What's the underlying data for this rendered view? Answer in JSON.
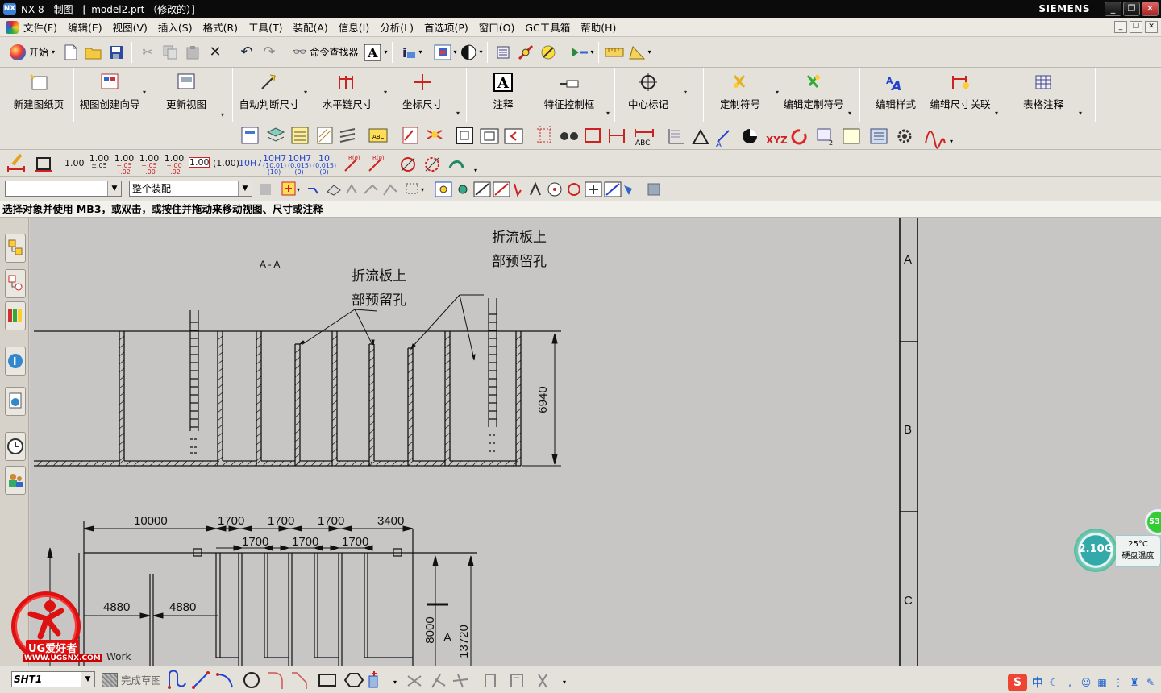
{
  "window": {
    "title": "NX 8 - 制图 - [_model2.prt （修改的）]",
    "brand": "SIEMENS",
    "controls": [
      "_",
      "❐",
      "✕"
    ]
  },
  "menubar": {
    "items": [
      "文件(F)",
      "编辑(E)",
      "视图(V)",
      "插入(S)",
      "格式(R)",
      "工具(T)",
      "装配(A)",
      "信息(I)",
      "分析(L)",
      "首选项(P)",
      "窗口(O)",
      "GC工具箱",
      "帮助(H)"
    ]
  },
  "standard_toolbar": {
    "start_label": "开始",
    "command_finder_label": "命令查找器"
  },
  "drafting_toolbar": {
    "buttons": [
      "新建图纸页",
      "视图创建向导",
      "更新视图",
      "自动判断尺寸",
      "水平链尺寸",
      "坐标尺寸",
      "注释",
      "特征控制框",
      "中心标记",
      "定制符号",
      "编辑定制符号",
      "编辑样式",
      "编辑尺寸关联",
      "表格注释"
    ]
  },
  "dimension_toolbar": {
    "tolerance_labels": [
      {
        "main": "1.00",
        "sub": ""
      },
      {
        "main": "1.00",
        "sub": "±.05"
      },
      {
        "main": "1.00",
        "sub": "+.05 -.02"
      },
      {
        "main": "1.00",
        "sub": "+.05 -.00"
      },
      {
        "main": "1.00",
        "sub": "+.00 -.02"
      },
      {
        "main": "1.00",
        "sub": ""
      },
      {
        "main": "(1.00)",
        "sub": ""
      },
      {
        "main": "10H7",
        "sub": ""
      },
      {
        "main": "10H7",
        "sub": "(10.01)(10)"
      },
      {
        "main": "10H7",
        "sub": "(0.015)(0)"
      },
      {
        "main": "10",
        "sub": "(0.015)(0)"
      }
    ]
  },
  "selection_bar": {
    "filter_value": "",
    "scope_value": "整个装配"
  },
  "status": {
    "prompt": "选择对象并使用 MB3，或双击，或按住并拖动来移动视图、尺寸或注释"
  },
  "drawing": {
    "section_label": "A - A",
    "note_top": [
      "折流板上",
      "部预留孔"
    ],
    "note_mid": [
      "折流板上",
      "部预留孔"
    ],
    "dim_6940": "6940",
    "dims_top_row": [
      "10000",
      "1700",
      "1700",
      "1700",
      "3400"
    ],
    "dims_second_row": [
      "1700",
      "1700",
      "1700"
    ],
    "dims_left": [
      "4880",
      "4880"
    ],
    "dim_8000": "8000",
    "dim_13720": "13720",
    "label_a": "A",
    "border_zones": [
      "A",
      "B",
      "C"
    ],
    "work_label": "Work"
  },
  "sketch_toolbar": {
    "sheet_value": "SHT1",
    "finish_sketch_label": "完成草图"
  },
  "disk_widget": {
    "value": "2.10G",
    "temperature": "25°C",
    "label": "硬盘温度",
    "badge": "53"
  },
  "watermark": {
    "brand": "UG爱好者",
    "url": "WWW.UGSNX.COM"
  },
  "tray": {
    "ime_label": "中",
    "sogou": "S"
  },
  "colors": {
    "titlebar": "#0b0b0b",
    "canvas": "#c7c6c4",
    "toolbar": "#e4e1da",
    "accent_red": "#d11111",
    "line": "#111111"
  }
}
